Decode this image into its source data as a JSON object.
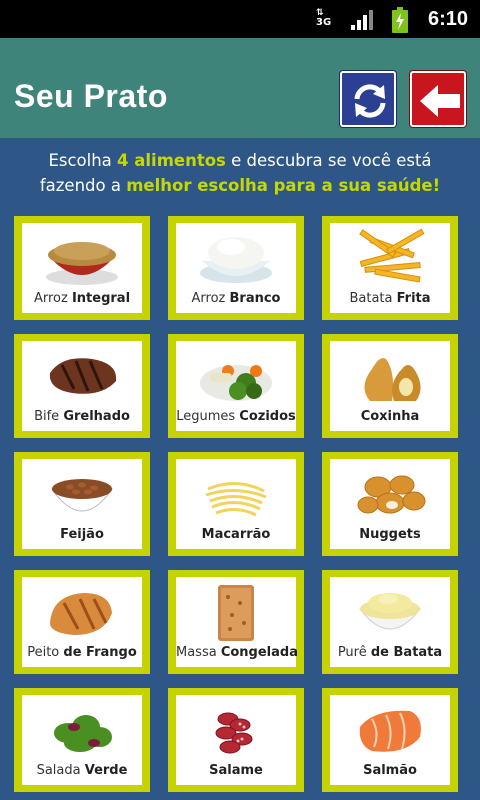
{
  "status": {
    "network": "3G",
    "time": "6:10"
  },
  "header": {
    "title": "Seu Prato"
  },
  "intro": {
    "l1a": "Escolha ",
    "l1b": "4 alimentos",
    "l1c": " e descubra se você está",
    "l2a": "fazendo a ",
    "l2b": "melhor escolha para a sua saúde!"
  },
  "foods": [
    {
      "light": "Arroz ",
      "bold": "Integral"
    },
    {
      "light": "Arroz ",
      "bold": "Branco"
    },
    {
      "light": "Batata ",
      "bold": "Frita"
    },
    {
      "light": "Bife ",
      "bold": "Grelhado"
    },
    {
      "light": "Legumes ",
      "bold": "Cozidos"
    },
    {
      "light": "",
      "bold": "Coxinha"
    },
    {
      "light": "",
      "bold": "Feijão"
    },
    {
      "light": "",
      "bold": "Macarrão"
    },
    {
      "light": "",
      "bold": "Nuggets"
    },
    {
      "light": "Peito ",
      "bold": "de Frango"
    },
    {
      "light": "Massa ",
      "bold": "Congelada"
    },
    {
      "light": "Purê ",
      "bold": "de Batata"
    },
    {
      "light": "Salada ",
      "bold": "Verde"
    },
    {
      "light": "",
      "bold": "Salame"
    },
    {
      "light": "",
      "bold": "Salmão"
    }
  ],
  "colors": {
    "background": "#2e5788",
    "header": "#3f847b",
    "accent": "#c6d800",
    "refresh": "#2b3f93",
    "back": "#c9151d"
  }
}
